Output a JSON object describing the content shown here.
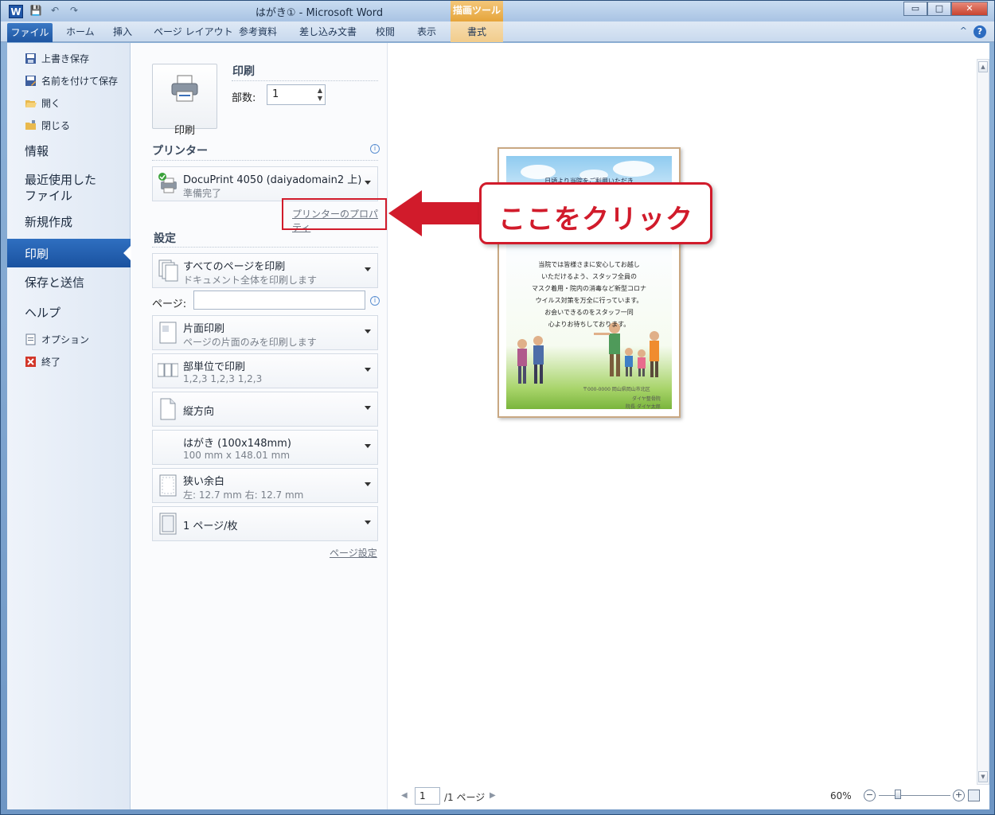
{
  "window": {
    "app_icon": "W",
    "title": "はがき① - Microsoft Word",
    "contextual_group": "描画ツール",
    "controls": {
      "minimize": "▭",
      "maximize": "□",
      "close": "✕"
    }
  },
  "ribbon": {
    "file_tab": "ファイル",
    "tabs": [
      "ホーム",
      "挿入",
      "ページ レイアウト",
      "参考資料",
      "差し込み文書",
      "校閲",
      "表示"
    ],
    "contextual_tab": "書式",
    "help": "?",
    "collapse": "^"
  },
  "nav": {
    "small_items": [
      {
        "label": "上書き保存",
        "icon": "save-icon"
      },
      {
        "label": "名前を付けて保存",
        "icon": "save-as-icon"
      },
      {
        "label": "開く",
        "icon": "open-folder-icon"
      },
      {
        "label": "閉じる",
        "icon": "close-folder-icon"
      }
    ],
    "big_items": [
      "情報",
      "最近使用した\nファイル",
      "新規作成"
    ],
    "selected": "印刷",
    "big_items_after": [
      "保存と送信",
      "ヘルプ"
    ],
    "footer_items": [
      {
        "label": "オプション",
        "icon": "options-icon"
      },
      {
        "label": "終了",
        "icon": "exit-icon"
      }
    ]
  },
  "print": {
    "section_title": "印刷",
    "button_label": "印刷",
    "copies_label": "部数:",
    "copies_value": "1"
  },
  "printer": {
    "section_title": "プリンター",
    "name": "DocuPrint 4050 (daiyadomain2 上)",
    "status": "準備完了",
    "properties_link": "プリンターのプロパティ"
  },
  "settings": {
    "section_title": "設定",
    "pages_label": "ページ:",
    "dropdowns": [
      {
        "main": "すべてのページを印刷",
        "sub": "ドキュメント全体を印刷します",
        "icon": "pages-stack-icon"
      },
      {
        "main": "片面印刷",
        "sub": "ページの片面のみを印刷します",
        "icon": "one-sided-icon"
      },
      {
        "main": "部単位で印刷",
        "sub": "1,2,3    1,2,3    1,2,3",
        "icon": "collate-icon"
      },
      {
        "main": "縦方向",
        "sub": "",
        "icon": "portrait-icon"
      },
      {
        "main": "はがき (100x148mm)",
        "sub": "100 mm x 148.01 mm",
        "icon": "paper-size-icon"
      },
      {
        "main": "狭い余白",
        "sub": "左:  12.7 mm     右:  12.7 mm",
        "icon": "margins-icon"
      },
      {
        "main": "1 ページ/枚",
        "sub": "",
        "icon": "pages-per-sheet-icon"
      }
    ],
    "page_setup_link": "ページ設定"
  },
  "preview": {
    "card_lines": [
      "当院では皆様さまに安心してお越し",
      "いただけるよう、スタッフ全員の",
      "マスク着用・院内の消毒など新型コロナ",
      "ウイルス対策を万全に行っています。",
      "お会いできるのをスタッフ一同",
      "心よりお待ちしております。"
    ],
    "card_header": "日頃より当院をご利用いただき",
    "card_footer_1": "〒000-0000  岡山県岡山市北区",
    "card_footer_2": "ダイヤ整骨院",
    "card_footer_3": "院長  ダイヤ太郎"
  },
  "callout": {
    "text": "ここをクリック",
    "color": "#d11b2b"
  },
  "status": {
    "page_value": "1",
    "page_total": "/1 ページ",
    "zoom": "60%"
  }
}
